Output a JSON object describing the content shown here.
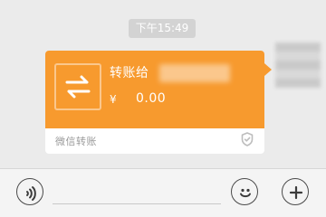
{
  "chat": {
    "timestamp": "下午15:49",
    "transfer": {
      "title": "转账给",
      "currency_symbol": "¥",
      "amount": "0.00",
      "footer_label": "微信转账"
    }
  },
  "colors": {
    "bubble_orange": "#f79a2e",
    "chat_background": "#ebebeb",
    "timestamp_bg": "#d3d3d3",
    "input_bar_bg": "#f4f4f4"
  },
  "icons": {
    "transfer": "transfer-arrows-icon",
    "shield": "shield-icon",
    "voice": "voice-icon",
    "emoji": "emoji-icon",
    "plus": "plus-icon"
  }
}
